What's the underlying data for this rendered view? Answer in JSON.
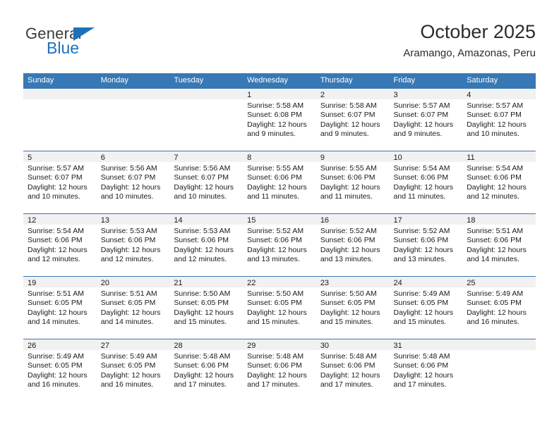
{
  "brand": {
    "name_top": "General",
    "name_bottom": "Blue",
    "accent_color": "#1c71bd"
  },
  "header": {
    "title": "October 2025",
    "location": "Aramango, Amazonas, Peru"
  },
  "calendar": {
    "header_bg": "#3878b4",
    "daynum_bg": "#f1f1f1",
    "weekdays": [
      "Sunday",
      "Monday",
      "Tuesday",
      "Wednesday",
      "Thursday",
      "Friday",
      "Saturday"
    ],
    "weeks": [
      [
        {
          "day": "",
          "empty": true,
          "sunrise": "",
          "sunset": "",
          "daylight_line1": "",
          "daylight_line2": ""
        },
        {
          "day": "",
          "empty": true,
          "sunrise": "",
          "sunset": "",
          "daylight_line1": "",
          "daylight_line2": ""
        },
        {
          "day": "",
          "empty": true,
          "sunrise": "",
          "sunset": "",
          "daylight_line1": "",
          "daylight_line2": ""
        },
        {
          "day": "1",
          "empty": false,
          "sunrise": "Sunrise: 5:58 AM",
          "sunset": "Sunset: 6:08 PM",
          "daylight_line1": "Daylight: 12 hours",
          "daylight_line2": "and 9 minutes."
        },
        {
          "day": "2",
          "empty": false,
          "sunrise": "Sunrise: 5:58 AM",
          "sunset": "Sunset: 6:07 PM",
          "daylight_line1": "Daylight: 12 hours",
          "daylight_line2": "and 9 minutes."
        },
        {
          "day": "3",
          "empty": false,
          "sunrise": "Sunrise: 5:57 AM",
          "sunset": "Sunset: 6:07 PM",
          "daylight_line1": "Daylight: 12 hours",
          "daylight_line2": "and 9 minutes."
        },
        {
          "day": "4",
          "empty": false,
          "sunrise": "Sunrise: 5:57 AM",
          "sunset": "Sunset: 6:07 PM",
          "daylight_line1": "Daylight: 12 hours",
          "daylight_line2": "and 10 minutes."
        }
      ],
      [
        {
          "day": "5",
          "empty": false,
          "sunrise": "Sunrise: 5:57 AM",
          "sunset": "Sunset: 6:07 PM",
          "daylight_line1": "Daylight: 12 hours",
          "daylight_line2": "and 10 minutes."
        },
        {
          "day": "6",
          "empty": false,
          "sunrise": "Sunrise: 5:56 AM",
          "sunset": "Sunset: 6:07 PM",
          "daylight_line1": "Daylight: 12 hours",
          "daylight_line2": "and 10 minutes."
        },
        {
          "day": "7",
          "empty": false,
          "sunrise": "Sunrise: 5:56 AM",
          "sunset": "Sunset: 6:07 PM",
          "daylight_line1": "Daylight: 12 hours",
          "daylight_line2": "and 10 minutes."
        },
        {
          "day": "8",
          "empty": false,
          "sunrise": "Sunrise: 5:55 AM",
          "sunset": "Sunset: 6:06 PM",
          "daylight_line1": "Daylight: 12 hours",
          "daylight_line2": "and 11 minutes."
        },
        {
          "day": "9",
          "empty": false,
          "sunrise": "Sunrise: 5:55 AM",
          "sunset": "Sunset: 6:06 PM",
          "daylight_line1": "Daylight: 12 hours",
          "daylight_line2": "and 11 minutes."
        },
        {
          "day": "10",
          "empty": false,
          "sunrise": "Sunrise: 5:54 AM",
          "sunset": "Sunset: 6:06 PM",
          "daylight_line1": "Daylight: 12 hours",
          "daylight_line2": "and 11 minutes."
        },
        {
          "day": "11",
          "empty": false,
          "sunrise": "Sunrise: 5:54 AM",
          "sunset": "Sunset: 6:06 PM",
          "daylight_line1": "Daylight: 12 hours",
          "daylight_line2": "and 12 minutes."
        }
      ],
      [
        {
          "day": "12",
          "empty": false,
          "sunrise": "Sunrise: 5:54 AM",
          "sunset": "Sunset: 6:06 PM",
          "daylight_line1": "Daylight: 12 hours",
          "daylight_line2": "and 12 minutes."
        },
        {
          "day": "13",
          "empty": false,
          "sunrise": "Sunrise: 5:53 AM",
          "sunset": "Sunset: 6:06 PM",
          "daylight_line1": "Daylight: 12 hours",
          "daylight_line2": "and 12 minutes."
        },
        {
          "day": "14",
          "empty": false,
          "sunrise": "Sunrise: 5:53 AM",
          "sunset": "Sunset: 6:06 PM",
          "daylight_line1": "Daylight: 12 hours",
          "daylight_line2": "and 12 minutes."
        },
        {
          "day": "15",
          "empty": false,
          "sunrise": "Sunrise: 5:52 AM",
          "sunset": "Sunset: 6:06 PM",
          "daylight_line1": "Daylight: 12 hours",
          "daylight_line2": "and 13 minutes."
        },
        {
          "day": "16",
          "empty": false,
          "sunrise": "Sunrise: 5:52 AM",
          "sunset": "Sunset: 6:06 PM",
          "daylight_line1": "Daylight: 12 hours",
          "daylight_line2": "and 13 minutes."
        },
        {
          "day": "17",
          "empty": false,
          "sunrise": "Sunrise: 5:52 AM",
          "sunset": "Sunset: 6:06 PM",
          "daylight_line1": "Daylight: 12 hours",
          "daylight_line2": "and 13 minutes."
        },
        {
          "day": "18",
          "empty": false,
          "sunrise": "Sunrise: 5:51 AM",
          "sunset": "Sunset: 6:06 PM",
          "daylight_line1": "Daylight: 12 hours",
          "daylight_line2": "and 14 minutes."
        }
      ],
      [
        {
          "day": "19",
          "empty": false,
          "sunrise": "Sunrise: 5:51 AM",
          "sunset": "Sunset: 6:05 PM",
          "daylight_line1": "Daylight: 12 hours",
          "daylight_line2": "and 14 minutes."
        },
        {
          "day": "20",
          "empty": false,
          "sunrise": "Sunrise: 5:51 AM",
          "sunset": "Sunset: 6:05 PM",
          "daylight_line1": "Daylight: 12 hours",
          "daylight_line2": "and 14 minutes."
        },
        {
          "day": "21",
          "empty": false,
          "sunrise": "Sunrise: 5:50 AM",
          "sunset": "Sunset: 6:05 PM",
          "daylight_line1": "Daylight: 12 hours",
          "daylight_line2": "and 15 minutes."
        },
        {
          "day": "22",
          "empty": false,
          "sunrise": "Sunrise: 5:50 AM",
          "sunset": "Sunset: 6:05 PM",
          "daylight_line1": "Daylight: 12 hours",
          "daylight_line2": "and 15 minutes."
        },
        {
          "day": "23",
          "empty": false,
          "sunrise": "Sunrise: 5:50 AM",
          "sunset": "Sunset: 6:05 PM",
          "daylight_line1": "Daylight: 12 hours",
          "daylight_line2": "and 15 minutes."
        },
        {
          "day": "24",
          "empty": false,
          "sunrise": "Sunrise: 5:49 AM",
          "sunset": "Sunset: 6:05 PM",
          "daylight_line1": "Daylight: 12 hours",
          "daylight_line2": "and 15 minutes."
        },
        {
          "day": "25",
          "empty": false,
          "sunrise": "Sunrise: 5:49 AM",
          "sunset": "Sunset: 6:05 PM",
          "daylight_line1": "Daylight: 12 hours",
          "daylight_line2": "and 16 minutes."
        }
      ],
      [
        {
          "day": "26",
          "empty": false,
          "sunrise": "Sunrise: 5:49 AM",
          "sunset": "Sunset: 6:05 PM",
          "daylight_line1": "Daylight: 12 hours",
          "daylight_line2": "and 16 minutes."
        },
        {
          "day": "27",
          "empty": false,
          "sunrise": "Sunrise: 5:49 AM",
          "sunset": "Sunset: 6:05 PM",
          "daylight_line1": "Daylight: 12 hours",
          "daylight_line2": "and 16 minutes."
        },
        {
          "day": "28",
          "empty": false,
          "sunrise": "Sunrise: 5:48 AM",
          "sunset": "Sunset: 6:06 PM",
          "daylight_line1": "Daylight: 12 hours",
          "daylight_line2": "and 17 minutes."
        },
        {
          "day": "29",
          "empty": false,
          "sunrise": "Sunrise: 5:48 AM",
          "sunset": "Sunset: 6:06 PM",
          "daylight_line1": "Daylight: 12 hours",
          "daylight_line2": "and 17 minutes."
        },
        {
          "day": "30",
          "empty": false,
          "sunrise": "Sunrise: 5:48 AM",
          "sunset": "Sunset: 6:06 PM",
          "daylight_line1": "Daylight: 12 hours",
          "daylight_line2": "and 17 minutes."
        },
        {
          "day": "31",
          "empty": false,
          "sunrise": "Sunrise: 5:48 AM",
          "sunset": "Sunset: 6:06 PM",
          "daylight_line1": "Daylight: 12 hours",
          "daylight_line2": "and 17 minutes."
        },
        {
          "day": "",
          "empty": true,
          "sunrise": "",
          "sunset": "",
          "daylight_line1": "",
          "daylight_line2": ""
        }
      ]
    ]
  }
}
